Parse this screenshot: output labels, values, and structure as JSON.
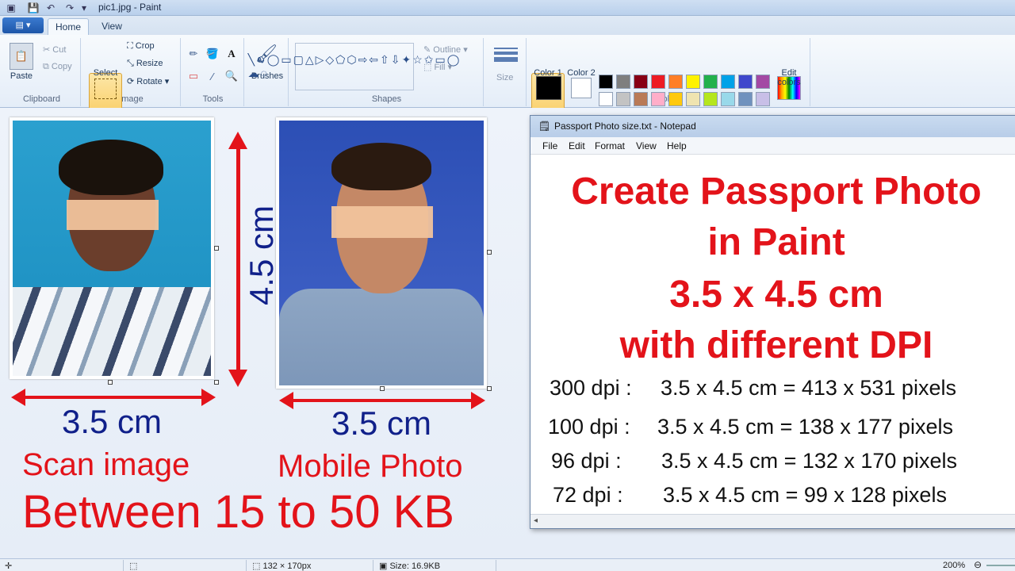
{
  "window": {
    "title": "pic1.jpg - Paint"
  },
  "tabs": [
    {
      "label": "Home"
    },
    {
      "label": "View"
    }
  ],
  "ribbon": {
    "clipboard": {
      "paste": "Paste",
      "cut": "Cut",
      "copy": "Copy",
      "group": "Clipboard"
    },
    "image": {
      "select": "Select",
      "crop": "Crop",
      "resize": "Resize",
      "rotate": "Rotate",
      "group": "Image"
    },
    "tools": {
      "group": "Tools"
    },
    "brushes": {
      "label": "Brushes"
    },
    "shapes": {
      "outline": "Outline",
      "fill": "Fill",
      "group": "Shapes"
    },
    "size": {
      "label": "Size"
    },
    "colors": {
      "color1": "Color 1",
      "color2": "Color 2",
      "edit": "Edit colors",
      "group": "Colors",
      "palette_row1": [
        "#000000",
        "#7f7f7f",
        "#880015",
        "#ed1c24",
        "#ff7f27",
        "#fff200",
        "#22b14c",
        "#00a2e8",
        "#3f48cc",
        "#a349a4"
      ],
      "palette_row2": [
        "#ffffff",
        "#c3c3c3",
        "#b97a57",
        "#ffaec9",
        "#ffc90e",
        "#efe4b0",
        "#b5e61d",
        "#99d9ea",
        "#7092be",
        "#c8bfe7"
      ]
    }
  },
  "canvas": {
    "height_label": "4.5 cm",
    "width_label_left": "3.5 cm",
    "width_label_right": "3.5 cm",
    "caption_left": "Scan image",
    "caption_right": "Mobile Photo",
    "size_range": "Between 15 to 50 KB"
  },
  "notepad": {
    "title": "Passport Photo size.txt - Notepad",
    "menus": [
      "File",
      "Edit",
      "Format",
      "View",
      "Help"
    ],
    "heading": [
      "Create Passport Photo",
      "in Paint",
      "3.5 x 4.5 cm",
      "with different DPI"
    ],
    "lines": [
      {
        "dpi": "300 dpi :",
        "size": "3.5 x 4.5 cm = 413 x 531 pixels"
      },
      {
        "dpi": "100 dpi :",
        "size": "3.5 x 4.5 cm = 138 x 177 pixels"
      },
      {
        "dpi": "96 dpi :",
        "size": "3.5 x 4.5 cm = 132 x 170 pixels"
      },
      {
        "dpi": "72 dpi :",
        "size": "3.5 x 4.5 cm =  99 x 128 pixels"
      }
    ]
  },
  "status": {
    "dimensions": "132 × 170px",
    "filesize": "Size: 16.9KB",
    "zoom": "200%"
  }
}
